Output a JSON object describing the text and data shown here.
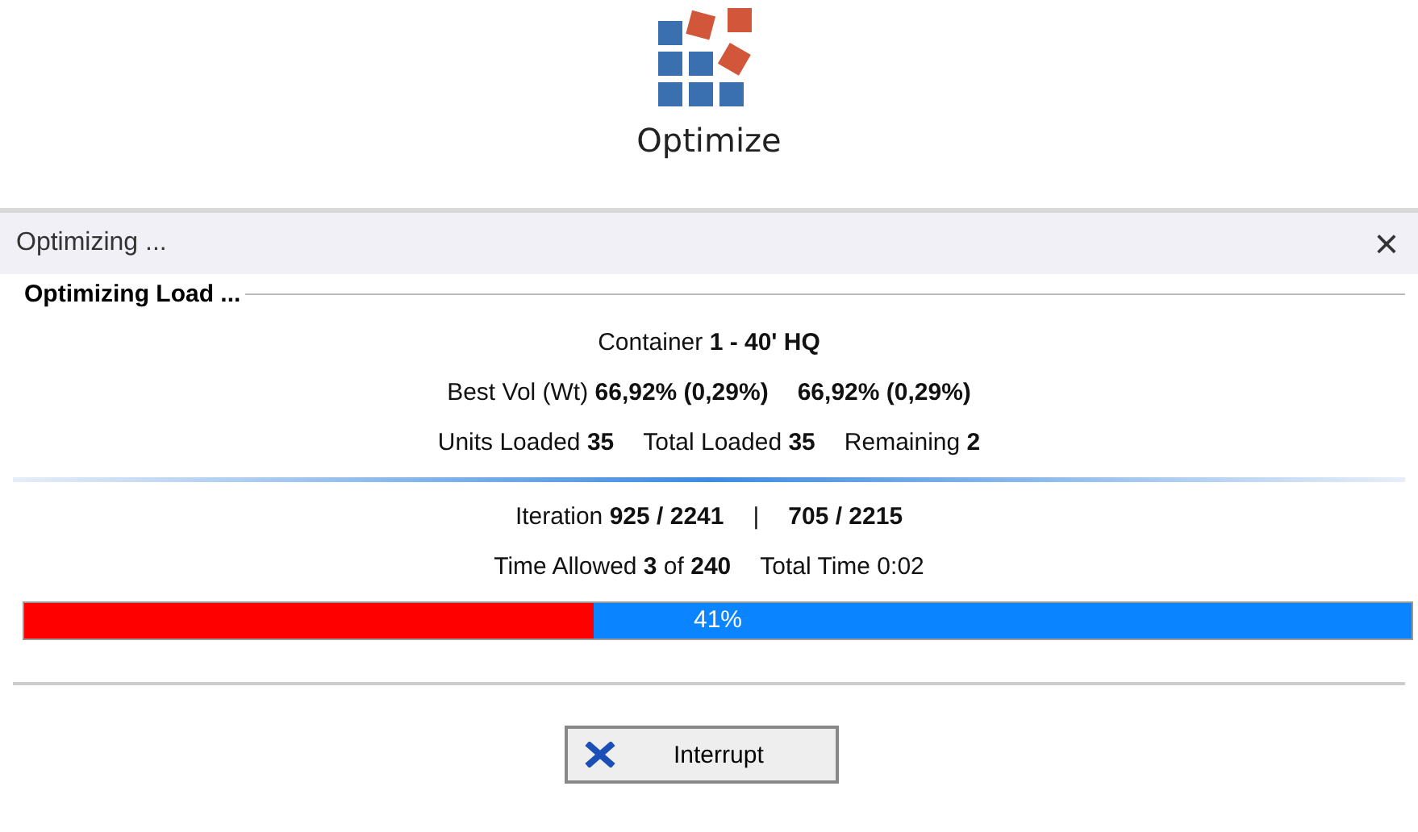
{
  "app_button": {
    "label": "Optimize"
  },
  "dialog": {
    "title": "Optimizing ...",
    "close": "×",
    "group_label": "Optimizing Load ...",
    "stats_lines": [
      [
        {
          "text": "Container **1 - 40' HQ**"
        }
      ],
      [
        {
          "text": "Best Vol (Wt)  **66,92% (0,29%)**"
        },
        {
          "text": "**66,92% (0,29%)**"
        }
      ],
      [
        {
          "text": "Units Loaded **35**"
        },
        {
          "text": "Total Loaded **35**"
        },
        {
          "text": "Remaining **2**"
        }
      ]
    ],
    "progress_lines": [
      [
        {
          "text": "Iteration  **925 / 2241**"
        },
        {
          "text": "|"
        },
        {
          "text": "**705 / 2215**"
        }
      ],
      [
        {
          "text": "Time Allowed **3** of **240**"
        },
        {
          "text": "Total Time 0:02"
        }
      ]
    ],
    "progress": {
      "level": 0.41,
      "reading": "41%"
    },
    "buttons": [
      {
        "label": "Interrupt"
      }
    ]
  }
}
